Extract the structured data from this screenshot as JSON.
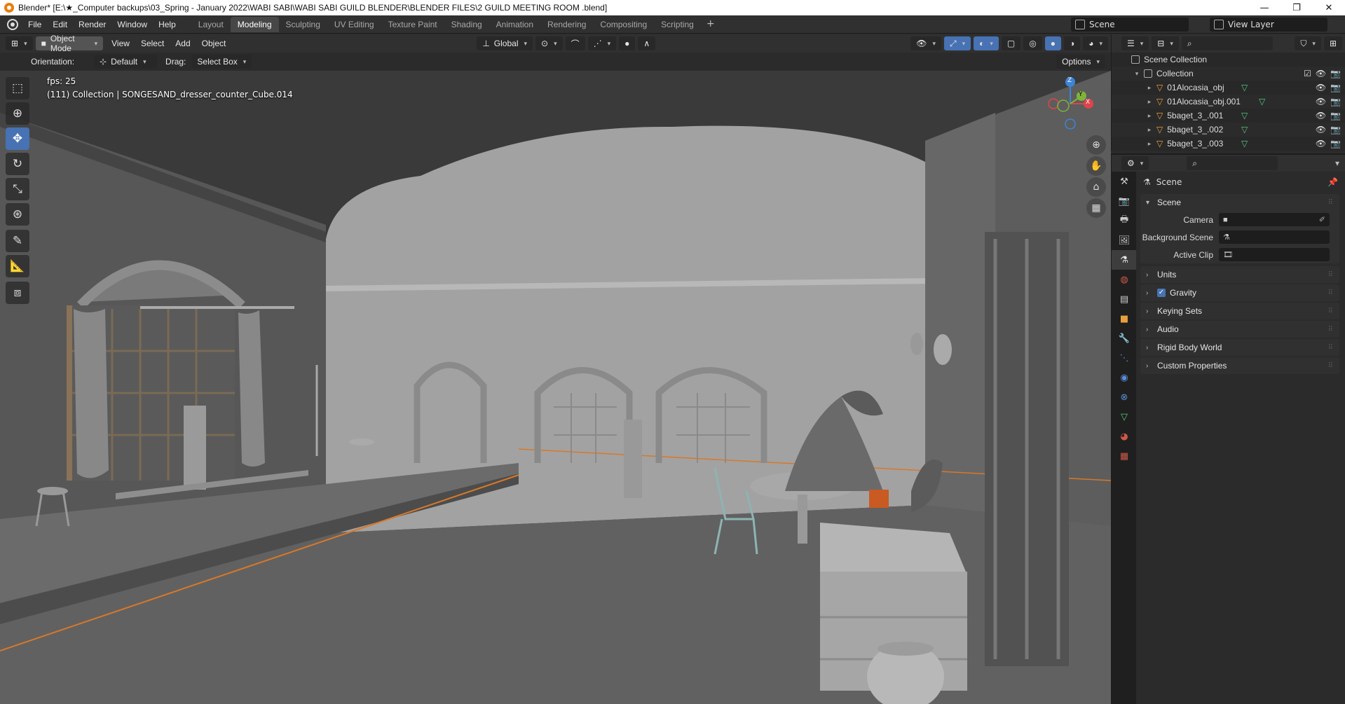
{
  "window": {
    "title": "Blender* [E:\\★_Computer backups\\03_Spring - January 2022\\WABI SABI\\WABI SABI GUILD BLENDER\\BLENDER FILES\\2 GUILD MEETING ROOM .blend]",
    "minimize": "—",
    "maximize": "❐",
    "close": "✕"
  },
  "menu": [
    "File",
    "Edit",
    "Render",
    "Window",
    "Help"
  ],
  "workspaces": [
    "Layout",
    "Modeling",
    "Sculpting",
    "UV Editing",
    "Texture Paint",
    "Shading",
    "Animation",
    "Rendering",
    "Compositing",
    "Scripting"
  ],
  "active_workspace": "Modeling",
  "scene_name": "Scene",
  "view_layer": "View Layer",
  "viewport_header": {
    "mode": "Object Mode",
    "menus": [
      "View",
      "Select",
      "Add",
      "Object"
    ],
    "transform_orientation": "Global",
    "options": "Options"
  },
  "tool_settings": {
    "orientation_label": "Orientation:",
    "orientation_value": "Default",
    "drag_label": "Drag:",
    "drag_value": "Select Box"
  },
  "overlay": {
    "fps": "fps: 25",
    "info": "(111) Collection | SONGESAND_dresser_counter_Cube.014"
  },
  "gizmo": {
    "z": "Z",
    "y": "Y",
    "x": "X"
  },
  "tools": [
    "select-box",
    "cursor",
    "move",
    "rotate",
    "scale",
    "transform",
    "annotate",
    "measure",
    "add-cube"
  ],
  "outliner": {
    "root": "Scene Collection",
    "collection": "Collection",
    "items": [
      "01Alocasia_obj",
      "01Alocasia_obj.001",
      "5baget_3_.001",
      "5baget_3_.002",
      "5baget_3_.003"
    ]
  },
  "properties": {
    "context": "Scene",
    "scene_panel": "Scene",
    "fields": [
      {
        "label": "Camera",
        "value": ""
      },
      {
        "label": "Background Scene",
        "value": ""
      },
      {
        "label": "Active Clip",
        "value": ""
      }
    ],
    "panels": [
      "Units",
      "Gravity",
      "Keying Sets",
      "Audio",
      "Rigid Body World",
      "Custom Properties"
    ]
  },
  "colors": {
    "accent": "#4772b3",
    "active_orange": "#e87d0d",
    "gizmo_x": "#e0434a",
    "gizmo_y": "#7fb33b",
    "gizmo_z": "#3d84d6"
  }
}
